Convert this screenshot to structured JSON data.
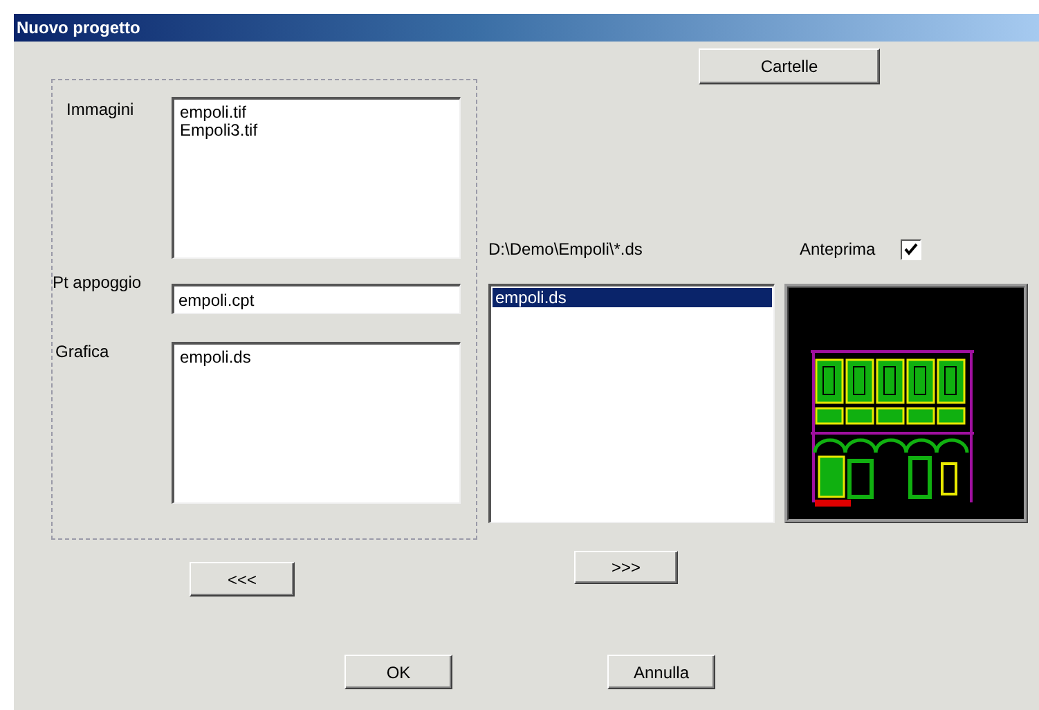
{
  "window": {
    "title": "Nuovo progetto"
  },
  "buttons": {
    "folders": "Cartelle",
    "remove": "<<<",
    "add": ">>>",
    "ok": "OK",
    "cancel": "Annulla"
  },
  "group": {
    "images": {
      "label": "Immagini",
      "items": [
        "empoli.tif",
        "Empoli3.tif"
      ]
    },
    "support_points": {
      "label": "Pt appoggio",
      "value": "empoli.cpt"
    },
    "graphics": {
      "label": "Grafica",
      "items": [
        "empoli.ds"
      ]
    }
  },
  "file_browser": {
    "path": "D:\\Demo\\Empoli\\*.ds",
    "files": [
      {
        "name": "empoli.ds",
        "selected": true
      }
    ]
  },
  "preview": {
    "label": "Anteprima",
    "checked": true
  }
}
